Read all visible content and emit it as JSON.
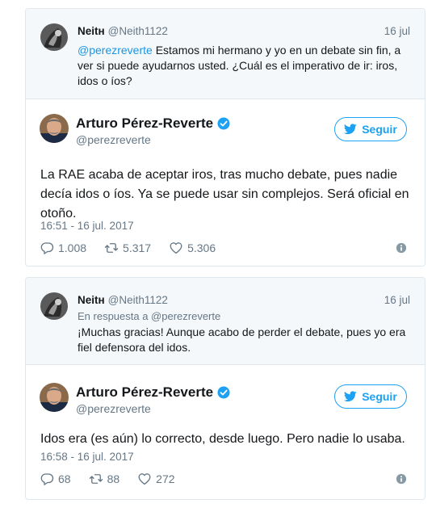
{
  "tweets": [
    {
      "reply": {
        "name": "Neitн",
        "handle": "@Neith1122",
        "date": "16 jul",
        "in_reply_to": "",
        "mention": "@perezreverte",
        "text": " Estamos mi hermano y yo en un debate sin fin, a ver si puede ayudarnos usted. ¿Cuál es el imperativo de ir: iros, idos o íos?"
      },
      "main": {
        "name": "Arturo Pérez-Reverte",
        "handle": "@perezreverte",
        "follow_label": "Seguir",
        "text": "La RAE acaba de aceptar iros, tras mucho debate, pues nadie decía idos o íos. Ya se puede usar sin complejos. Será oficial en otoño.",
        "timestamp": "16:51 - 16 jul. 2017",
        "replies": "1.008",
        "retweets": "5.317",
        "likes": "5.306"
      }
    },
    {
      "reply": {
        "name": "Neitн",
        "handle": "@Neith1122",
        "date": "16 jul",
        "in_reply_to": "En respuesta a @perezreverte",
        "mention": "",
        "text": "¡Muchas gracias! Aunque acabo de perder el debate, pues yo era fiel defensora del idos."
      },
      "main": {
        "name": "Arturo Pérez-Reverte",
        "handle": "@perezreverte",
        "follow_label": "Seguir",
        "text": "Idos era (es aún) lo correcto, desde luego. Pero nadie lo usaba.",
        "timestamp": "16:58 - 16 jul. 2017",
        "replies": "68",
        "retweets": "88",
        "likes": "272"
      }
    }
  ],
  "colors": {
    "accent": "#1da1f2",
    "mention": "#1b95e0",
    "secondary_text": "#657786",
    "reply_bg": "#f5f8fa",
    "border": "#e1e8ed"
  }
}
